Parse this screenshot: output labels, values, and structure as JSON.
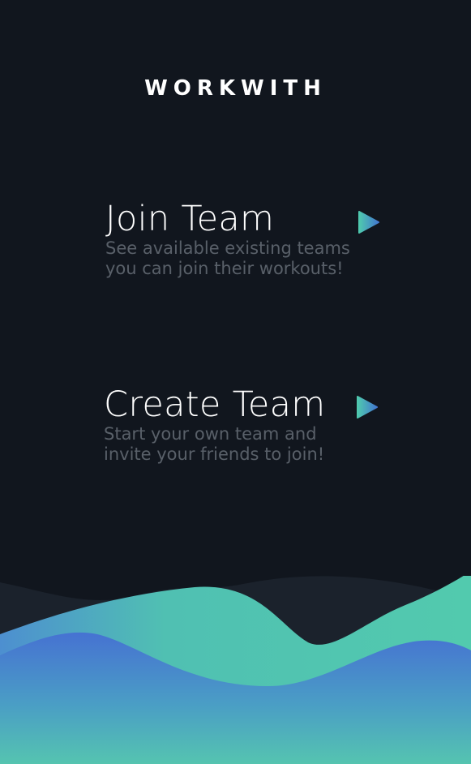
{
  "app": {
    "title": "WORKWITH"
  },
  "options": {
    "join": {
      "title": "Join Team",
      "description": "See available existing teams you can join their workouts!",
      "icon": "play-icon"
    },
    "create": {
      "title": "Create Team",
      "description": "Start your own team and invite your friends to join!",
      "icon": "play-icon"
    }
  },
  "colors": {
    "background": "#11161e",
    "title_text": "#ffffff",
    "description_text": "#596069",
    "accent_green": "#4fc9ae",
    "accent_blue": "#4272cf",
    "wave_shadow": "#1b222c"
  }
}
